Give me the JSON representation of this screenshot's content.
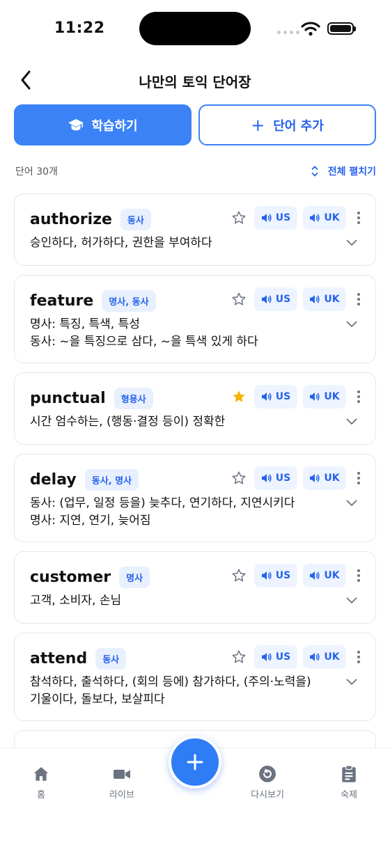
{
  "status_bar": {
    "time": "11:22"
  },
  "header": {
    "title": "나만의 토익 단어장"
  },
  "actions": {
    "study_label": "학습하기",
    "add_label": "단어 추가"
  },
  "list_info": {
    "count_label": "단어 30개",
    "expand_all_label": "전체 펼치기"
  },
  "audio": {
    "us_label": "US",
    "uk_label": "UK"
  },
  "words": [
    {
      "word": "authorize",
      "pos": "동사",
      "meaning_lines": [
        "승인하다, 허가하다, 권한을 부여하다"
      ],
      "starred": false
    },
    {
      "word": "feature",
      "pos": "명사, 동사",
      "meaning_lines": [
        "명사: 특징, 특색, 특성",
        "동사: ~을 특징으로 삼다, ~을 특색 있게 하다"
      ],
      "starred": false
    },
    {
      "word": "punctual",
      "pos": "형용사",
      "meaning_lines": [
        "시간 엄수하는, (행동·결정 등이) 정확한"
      ],
      "starred": true
    },
    {
      "word": "delay",
      "pos": "동사, 명사",
      "meaning_lines": [
        "동사: (업무, 일정 등을) 늦추다, 연기하다, 지연시키다",
        "명사: 지연, 연기, 늦어짐"
      ],
      "starred": false
    },
    {
      "word": "customer",
      "pos": "명사",
      "meaning_lines": [
        "고객, 소비자, 손님"
      ],
      "starred": false
    },
    {
      "word": "attend",
      "pos": "동사",
      "meaning_lines": [
        "참석하다, 출석하다, (회의 등에) 참가하다, (주의·노력을)",
        "기울이다, 돌보다, 보살피다"
      ],
      "starred": false
    }
  ],
  "tab_bar": {
    "items": [
      {
        "label": "홈",
        "icon": "home-icon"
      },
      {
        "label": "라이브",
        "icon": "video-camera-icon"
      },
      {
        "label": "다시보기",
        "icon": "replay-icon"
      },
      {
        "label": "숙제",
        "icon": "clipboard-icon"
      }
    ]
  },
  "colors": {
    "accent": "#3b82f6",
    "star_active": "#f5b301",
    "badge_bg": "#e8f0fe"
  }
}
